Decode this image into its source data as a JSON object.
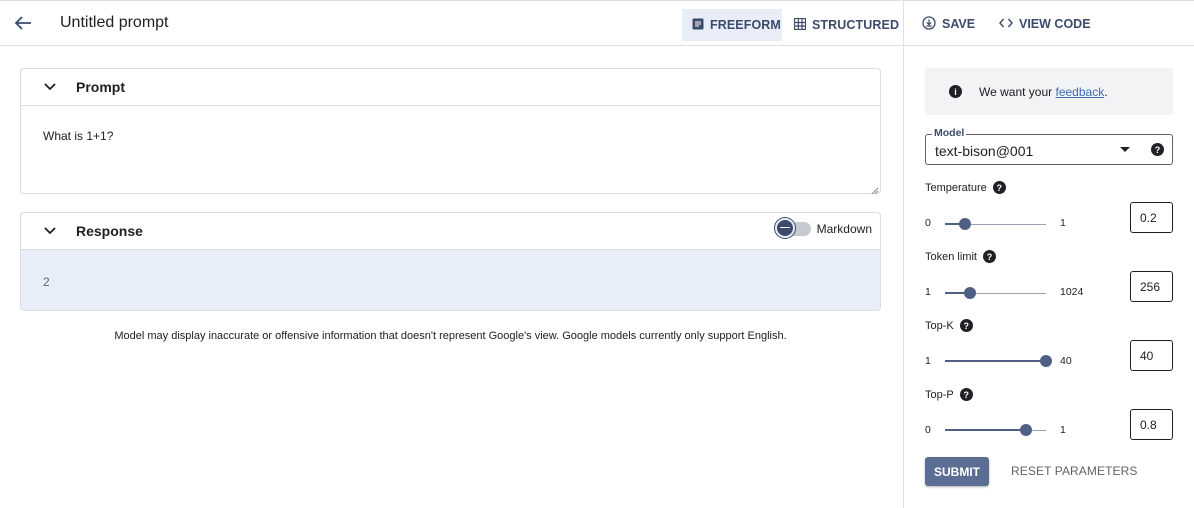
{
  "header": {
    "title": "Untitled prompt",
    "freeform_label": "FREEFORM",
    "structured_label": "STRUCTURED",
    "save_label": "SAVE",
    "view_code_label": "VIEW CODE"
  },
  "prompt": {
    "section_title": "Prompt",
    "text": "What is 1+1?"
  },
  "response": {
    "section_title": "Response",
    "text": "2",
    "markdown_label": "Markdown"
  },
  "disclaimer": "Model may display inaccurate or offensive information that doesn't represent Google's view. Google models currently only support English.",
  "feedback": {
    "prefix": "We want your ",
    "link": "feedback",
    "suffix": "."
  },
  "model": {
    "label": "Model",
    "value": "text-bison@001"
  },
  "parameters": [
    {
      "label": "Temperature",
      "min": "0",
      "max": "1",
      "value": "0.2",
      "fraction": 0.2
    },
    {
      "label": "Token limit",
      "min": "1",
      "max": "1024",
      "value": "256",
      "fraction": 0.25
    },
    {
      "label": "Top-K",
      "min": "1",
      "max": "40",
      "value": "40",
      "fraction": 1.0
    },
    {
      "label": "Top-P",
      "min": "0",
      "max": "1",
      "value": "0.8",
      "fraction": 0.8
    }
  ],
  "actions": {
    "submit_label": "SUBMIT",
    "reset_label": "RESET PARAMETERS"
  },
  "colors": {
    "accent": "#3c4a6b",
    "slider": "#4f5f85",
    "response_bg": "#e8eef9",
    "link": "#3c6bb4"
  }
}
